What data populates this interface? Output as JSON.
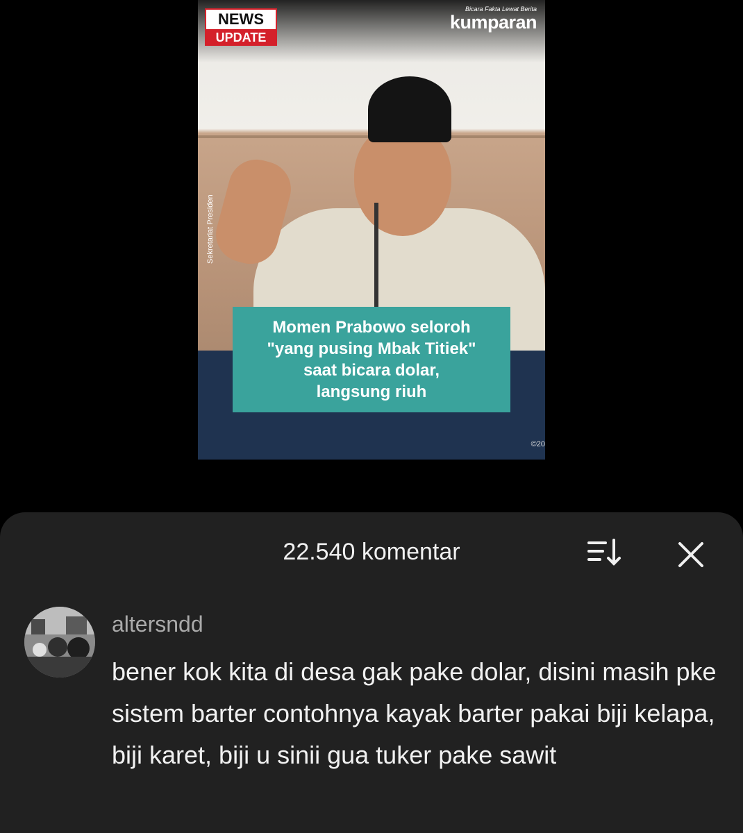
{
  "video": {
    "badge_top": "NEWS",
    "badge_bottom": "UPDATE",
    "brand_tagline": "Bicara Fakta Lewat Berita",
    "brand_name": "kumparan",
    "credit": "Sekretariat Presiden",
    "copyright": "©20",
    "caption_lines": [
      "Momen Prabowo seloroh",
      "\"yang pusing Mbak Titiek\"",
      "saat bicara dolar,",
      "langsung riuh"
    ]
  },
  "comments": {
    "count_label": "22.540 komentar",
    "items": [
      {
        "username": "altersndd",
        "text": "bener kok kita di desa gak pake dolar, disini masih pke sistem barter contohnya kayak barter pakai biji kelapa, biji karet, biji u sinii gua tuker pake sawit"
      }
    ]
  },
  "colors": {
    "sheet_bg": "#212121",
    "caption_bg": "#3aa39c",
    "badge_red": "#d4202a"
  },
  "icons": [
    "sort-icon",
    "close-icon"
  ]
}
